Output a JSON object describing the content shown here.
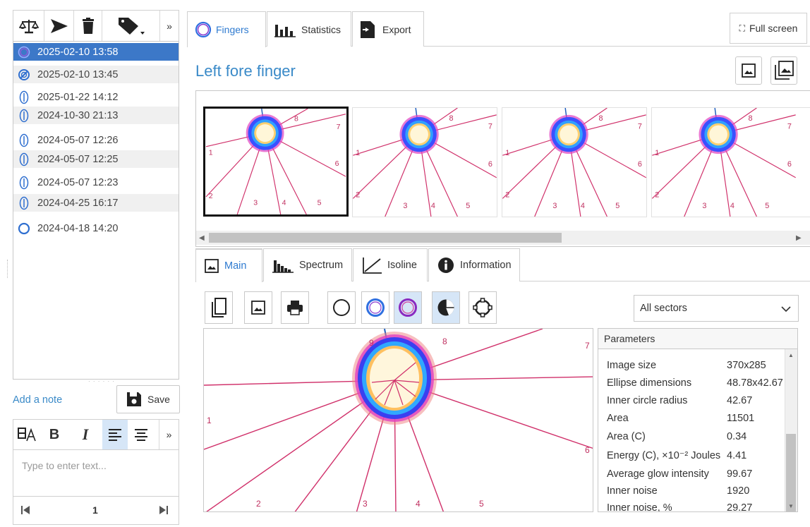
{
  "left_toolbar": {
    "icons": [
      "balance-scale-icon",
      "send-icon",
      "trash-icon",
      "tag-icon",
      "chevron-right-icon"
    ],
    "more_label": "»"
  },
  "sessions": [
    {
      "datetime": "2025-02-10 13:58",
      "icon": "double-ring-icon",
      "selected": true
    },
    {
      "datetime": "2025-02-10 13:45",
      "icon": "no-entry-icon",
      "selected": false
    },
    {
      "datetime": "2025-01-22 14:12",
      "icon": "finger-icon",
      "selected": false
    },
    {
      "datetime": "2024-10-30 21:13",
      "icon": "finger-icon",
      "selected": false
    },
    {
      "datetime": "2024-05-07 12:26",
      "icon": "finger-icon",
      "selected": false
    },
    {
      "datetime": "2024-05-07 12:25",
      "icon": "finger-icon",
      "selected": false
    },
    {
      "datetime": "2024-05-07 12:23",
      "icon": "finger-icon",
      "selected": false
    },
    {
      "datetime": "2024-04-25 16:17",
      "icon": "finger-icon",
      "selected": false
    },
    {
      "datetime": "2024-04-18 14:20",
      "icon": "ring-icon",
      "selected": false
    }
  ],
  "note": {
    "add_label": "Add a note",
    "save_label": "Save",
    "placeholder": "Type to enter text...",
    "more_label": "»"
  },
  "pager": {
    "page": "1"
  },
  "top_tabs": [
    {
      "label": "Fingers",
      "active": true
    },
    {
      "label": "Statistics",
      "active": false
    },
    {
      "label": "Export",
      "active": false
    }
  ],
  "full_screen_label": "Full screen",
  "finger_title": "Left fore finger",
  "sector_labels": [
    "1",
    "2",
    "3",
    "4",
    "5",
    "6",
    "7",
    "8"
  ],
  "main_sector_labels": [
    "1",
    "2",
    "3",
    "4",
    "5",
    "6",
    "7",
    "8",
    "9"
  ],
  "sub_tabs": [
    {
      "label": "Main",
      "active": true
    },
    {
      "label": "Spectrum",
      "active": false
    },
    {
      "label": "Isoline",
      "active": false
    },
    {
      "label": "Information",
      "active": false
    }
  ],
  "sector_select": {
    "value": "All sectors"
  },
  "parameters": {
    "title": "Parameters",
    "rows": [
      {
        "label": "Image size",
        "value": "370x285"
      },
      {
        "label": "Ellipse dimensions",
        "value": "48.78x42.67"
      },
      {
        "label": "Inner circle radius",
        "value": "42.67"
      },
      {
        "label": "Area",
        "value": "11501"
      },
      {
        "label": "Area (C)",
        "value": "0.34"
      },
      {
        "label": "Energy (C), ×10⁻² Joules",
        "value": "4.41"
      },
      {
        "label": "Average glow intensity",
        "value": "99.67"
      },
      {
        "label": "Inner noise",
        "value": "1920"
      },
      {
        "label": "Inner noise, %",
        "value": "29.27"
      }
    ]
  },
  "colors": {
    "accent": "#2f7bd0",
    "selected_row": "#3c78c8",
    "sector_line": "#d0306a",
    "active_button": "#d6e6f7"
  }
}
